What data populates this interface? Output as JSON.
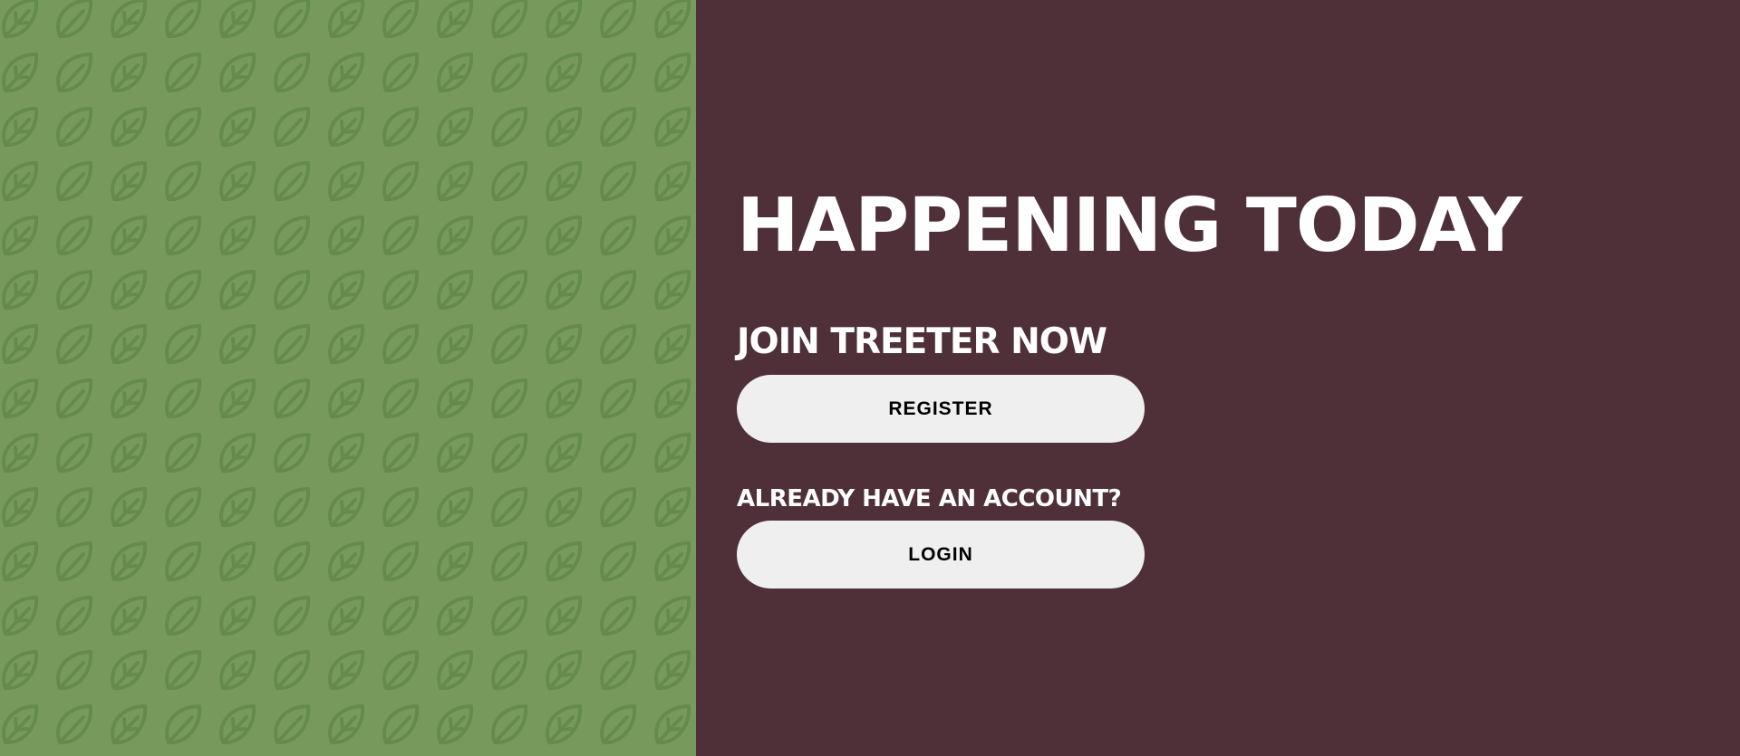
{
  "colors": {
    "left_background": "#779a5c",
    "leaf_pattern": "#648a4c",
    "right_background": "#4f3038",
    "heading_text": "#ffffff",
    "button_background": "#efefef",
    "button_text": "#000000"
  },
  "decor": {
    "pattern_icon": "leaf-icon"
  },
  "main": {
    "headline": "HAPPENING TODAY",
    "join_heading": "JOIN TREETER NOW",
    "register_label": "REGISTER",
    "account_heading": "ALREADY HAVE AN ACCOUNT?",
    "login_label": "LOGIN"
  }
}
